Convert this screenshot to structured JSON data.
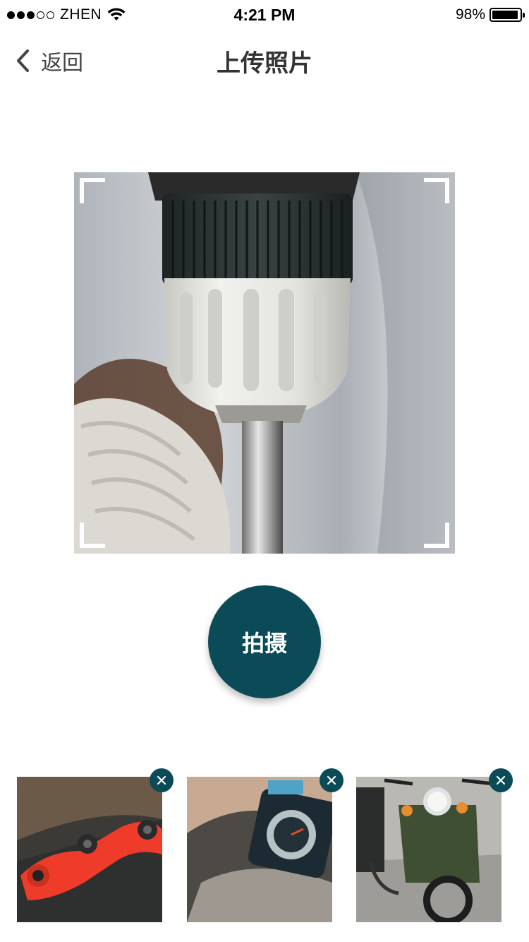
{
  "status_bar": {
    "carrier": "ZHEN",
    "time": "4:21 PM",
    "battery": "98%",
    "battery_level": 0.98,
    "signal_bars_filled": 3,
    "signal_bars_total": 5
  },
  "nav": {
    "back_label": "返回",
    "title": "上传照片"
  },
  "viewer": {
    "subject": "drill-chuck-photo"
  },
  "actions": {
    "shoot_label": "拍摄"
  },
  "thumbnails": [
    {
      "subject": "red-ratchet-wrench-photo",
      "remove_icon": "close-icon"
    },
    {
      "subject": "motorcycle-speedometer-photo",
      "remove_icon": "close-icon"
    },
    {
      "subject": "green-motorcycle-photo",
      "remove_icon": "close-icon"
    }
  ],
  "colors": {
    "accent": "#0b4a57",
    "title_text": "#333333"
  }
}
